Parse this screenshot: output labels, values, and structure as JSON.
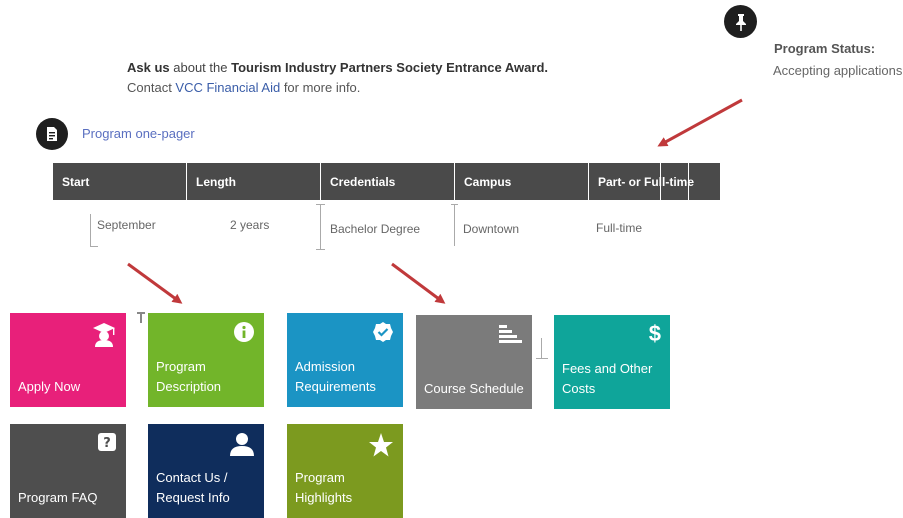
{
  "status": {
    "label": "Program Status:",
    "value": "Accepting applications"
  },
  "intro": {
    "line1_pre": "Ask us",
    "line1_mid": " about the ",
    "line1_award": "Tourism Industry Partners Society Entrance Award.",
    "line2_pre": "Contact ",
    "line2_link": "VCC Financial Aid",
    "line2_post": " for more info."
  },
  "one_pager": {
    "label": "Program one-pager"
  },
  "headers": [
    "Start",
    "Length",
    "Credentials",
    "Campus",
    "Part- or Full-time"
  ],
  "values": [
    "September",
    "2 years",
    "Bachelor Degree",
    "Downtown",
    "Full-time"
  ],
  "tiles": {
    "apply": {
      "label": "Apply Now",
      "color": "#e8207a"
    },
    "description": {
      "label": "Program Description",
      "color": "#72b52a"
    },
    "admission": {
      "label": "Admission Requirements",
      "color": "#1b94c4"
    },
    "schedule": {
      "label": "Course Schedule",
      "color": "#7b7b7b"
    },
    "fees": {
      "label": "Fees and Other Costs",
      "color": "#0fa59a"
    },
    "faq": {
      "label": "Program FAQ",
      "color": "#4e4e4e"
    },
    "contact": {
      "label": "Contact Us / Request Info",
      "color": "#0f2d5c"
    },
    "highlights": {
      "label": "Program Highlights",
      "color": "#7c9a1f"
    }
  },
  "icons": {
    "pin": "pushpin-icon",
    "doc": "document-icon",
    "grad": "graduation-cap-icon",
    "info": "info-icon",
    "check": "check-badge-icon",
    "chart": "bar-chart-icon",
    "dollar": "dollar-icon",
    "question": "question-icon",
    "person": "person-icon",
    "star": "star-icon"
  },
  "arrow_color": "#c0393b"
}
